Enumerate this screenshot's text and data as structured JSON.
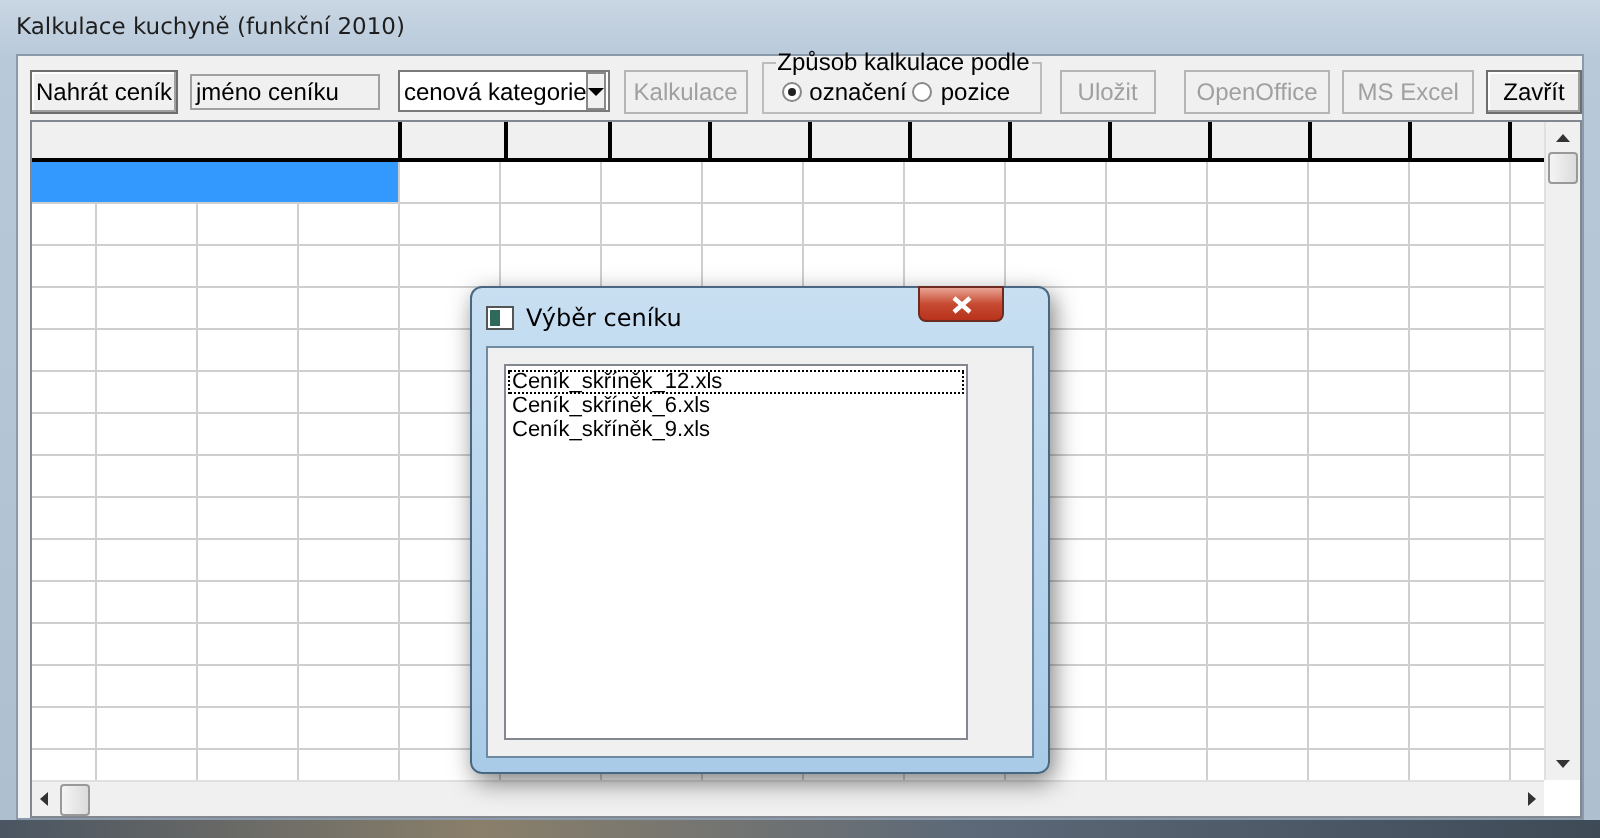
{
  "window": {
    "title": "Kalkulace kuchyně (funkční 2010)"
  },
  "toolbar": {
    "load_button": {
      "label": "Nahrát ceník",
      "disabled": false
    },
    "pricelist_name": {
      "value": "jméno ceníku"
    },
    "category_select": {
      "value": "cenová kategorie"
    },
    "calculate_button": {
      "label": "Kalkulace",
      "disabled": true
    },
    "calculation_mode": {
      "legend": "Způsob kalkulace podle",
      "options": [
        {
          "label": "označení",
          "selected": true
        },
        {
          "label": "pozice",
          "selected": false
        }
      ]
    },
    "action_buttons": [
      {
        "label": "Uložit",
        "disabled": true
      },
      {
        "label": "OpenOffice",
        "disabled": true
      },
      {
        "label": "MS Excel",
        "disabled": true
      },
      {
        "label": "Zavřít",
        "disabled": false
      }
    ]
  },
  "grid": {
    "first_cell_selected": true
  },
  "dialog": {
    "title": "Výběr ceníku",
    "files": [
      {
        "name": "Ceník_skříněk_12.xls",
        "focused": true
      },
      {
        "name": "Ceník_skříněk_6.xls",
        "focused": false
      },
      {
        "name": "Ceník_skříněk_9.xls",
        "focused": false
      }
    ]
  }
}
